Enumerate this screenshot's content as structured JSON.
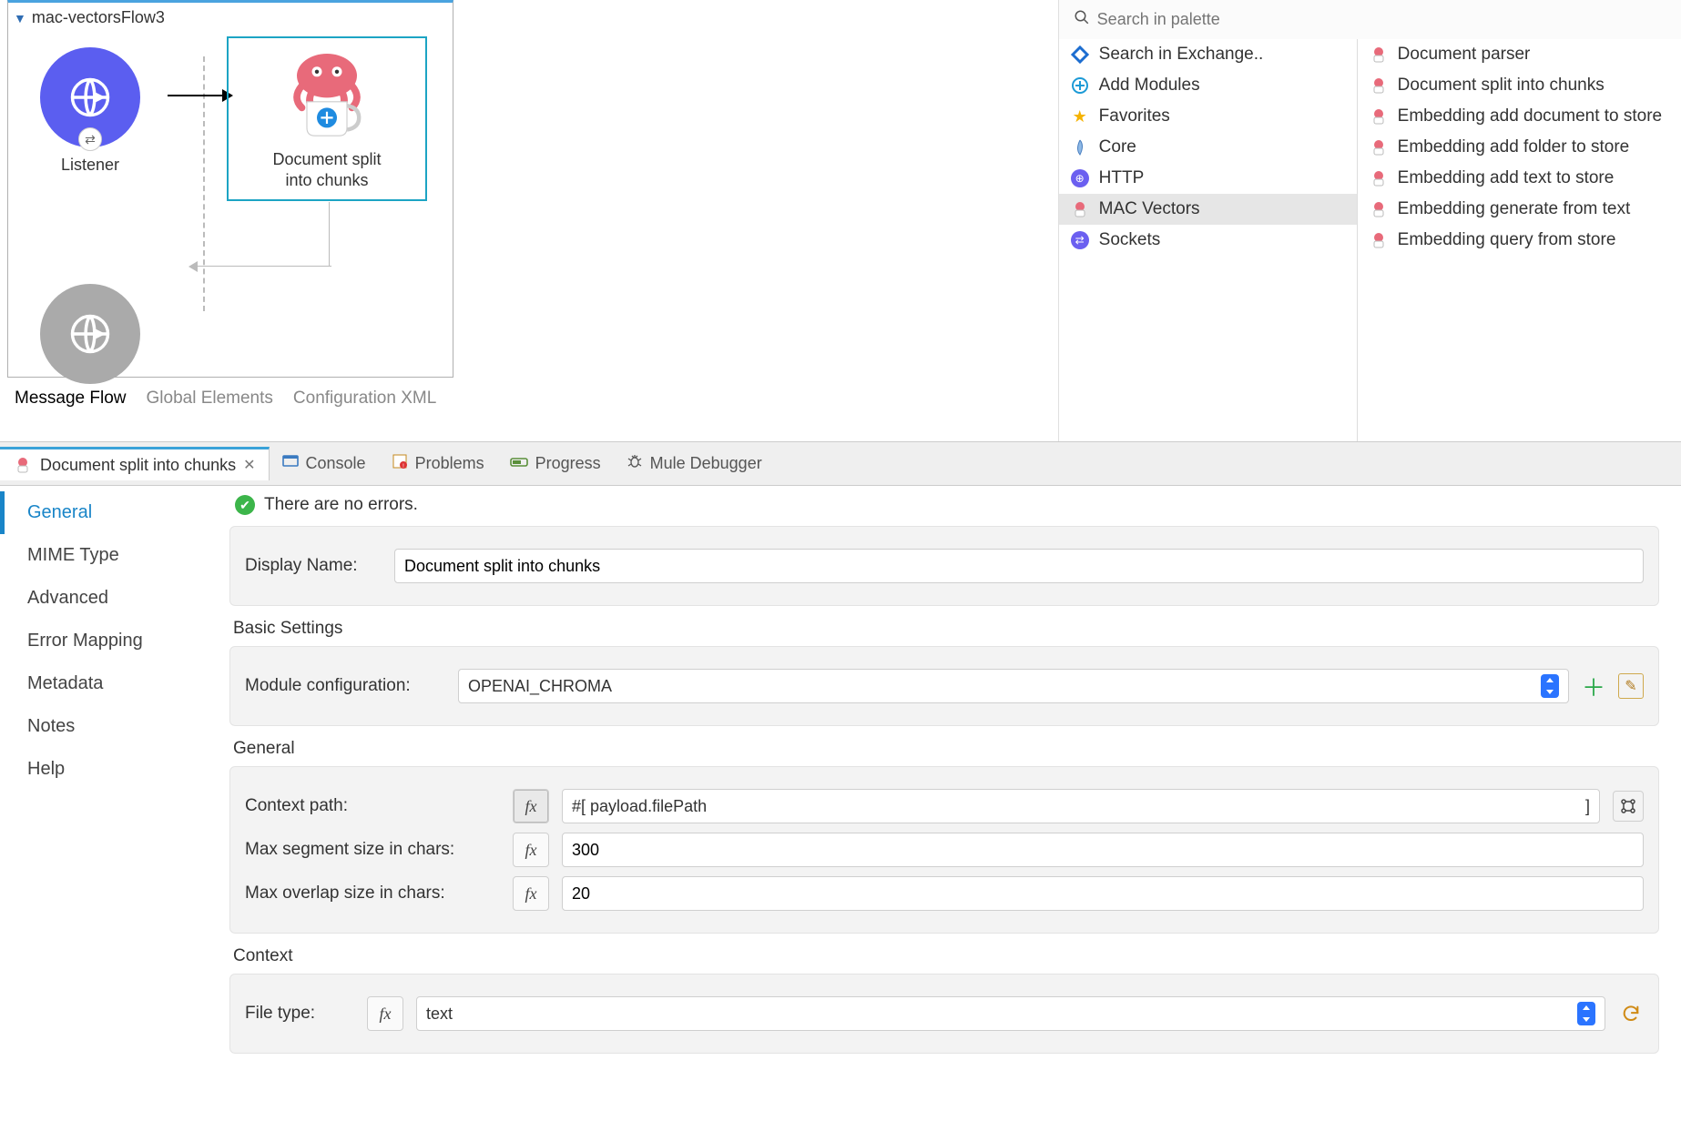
{
  "canvas": {
    "flow_name": "mac-vectorsFlow3",
    "listener_label": "Listener",
    "selected_node_label": "Document split\ninto chunks",
    "tabs": [
      "Message Flow",
      "Global Elements",
      "Configuration XML"
    ],
    "active_tab": "Message Flow"
  },
  "palette": {
    "search_placeholder": "Search in palette",
    "categories": [
      {
        "label": "Search in Exchange..",
        "icon": "exchange-icon"
      },
      {
        "label": "Add Modules",
        "icon": "plus-circle-icon"
      },
      {
        "label": "Favorites",
        "icon": "star-icon"
      },
      {
        "label": "Core",
        "icon": "core-icon"
      },
      {
        "label": "HTTP",
        "icon": "http-icon"
      },
      {
        "label": "MAC Vectors",
        "icon": "mac-vectors-icon",
        "selected": true
      },
      {
        "label": "Sockets",
        "icon": "sockets-icon"
      }
    ],
    "operations": [
      "Document parser",
      "Document split into chunks",
      "Embedding add document to store",
      "Embedding add folder to store",
      "Embedding add text to store",
      "Embedding generate from text",
      "Embedding query from store"
    ]
  },
  "panel": {
    "active_tab_label": "Document split into chunks",
    "other_tabs": [
      "Console",
      "Problems",
      "Progress",
      "Mule Debugger"
    ],
    "no_errors_text": "There are no errors.",
    "side_nav": [
      "General",
      "MIME Type",
      "Advanced",
      "Error Mapping",
      "Metadata",
      "Notes",
      "Help"
    ],
    "active_side": "General"
  },
  "form": {
    "display_name_label": "Display Name:",
    "display_name_value": "Document split into chunks",
    "basic_settings_title": "Basic Settings",
    "module_config_label": "Module configuration:",
    "module_config_value": "OPENAI_CHROMA",
    "general_title": "General",
    "context_path_label": "Context path:",
    "context_path_expr": "#[ payload.filePath",
    "context_path_expr_close": "]",
    "max_segment_label": "Max segment size in chars:",
    "max_segment_value": "300",
    "max_overlap_label": "Max overlap size in chars:",
    "max_overlap_value": "20",
    "context_title": "Context",
    "file_type_label": "File type:",
    "file_type_value": "text"
  }
}
